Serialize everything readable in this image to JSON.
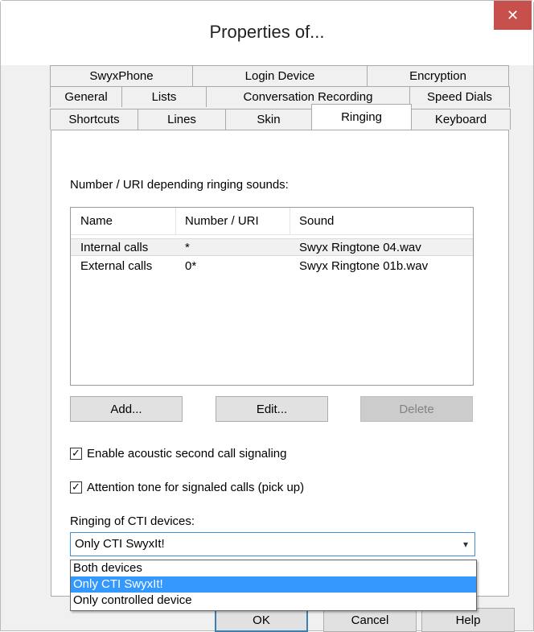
{
  "window": {
    "title": "Properties of..."
  },
  "tabs": {
    "row1": [
      "SwyxPhone",
      "Login Device",
      "Encryption"
    ],
    "row2": [
      "General",
      "Lists",
      "Conversation Recording",
      "Speed Dials"
    ],
    "row3": [
      "Shortcuts",
      "Lines",
      "Skin",
      "Ringing",
      "Keyboard"
    ],
    "active": "Ringing"
  },
  "ringing": {
    "section_label": "Number / URI depending ringing sounds:",
    "columns": [
      "Name",
      "Number / URI",
      "Sound"
    ],
    "rows": [
      {
        "name": "Internal calls",
        "number": "*",
        "sound": "Swyx Ringtone 04.wav"
      },
      {
        "name": "External calls",
        "number": "0*",
        "sound": "Swyx Ringtone 01b.wav"
      }
    ],
    "add_label": "Add...",
    "edit_label": "Edit...",
    "delete_label": "Delete",
    "check_second_call": {
      "label": "Enable acoustic second call signaling",
      "checked": true
    },
    "check_attention": {
      "label": "Attention tone for signaled calls (pick up)",
      "checked": true
    },
    "cti_label": "Ringing of CTI devices:",
    "cti_selected": "Only CTI SwyxIt!",
    "cti_options": [
      "Both devices",
      "Only CTI SwyxIt!",
      "Only controlled device"
    ]
  },
  "buttons": {
    "ok": "OK",
    "cancel": "Cancel",
    "help": "Help"
  },
  "icons": {
    "close": "close-icon",
    "check": "checkmark-icon",
    "dropdown": "chevron-down-icon"
  },
  "colors": {
    "close_bg": "#c7504c",
    "selection": "#3399ff",
    "focus_border": "#3f8fd9"
  }
}
